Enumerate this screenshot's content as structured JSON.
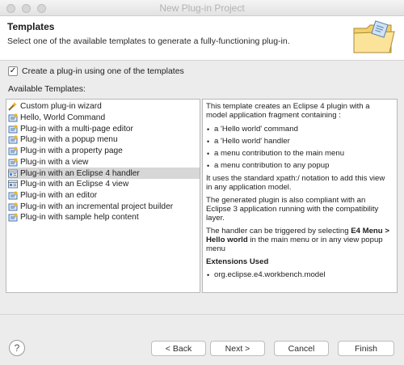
{
  "window": {
    "title": "New Plug-in Project"
  },
  "header": {
    "title": "Templates",
    "description": "Select one of the available templates to generate a fully-functioning plug-in."
  },
  "options": {
    "create_from_template_label": "Create a plug-in using one of the templates",
    "create_from_template_checked": true,
    "check_glyph": "✓"
  },
  "available_label": "Available Templates:",
  "templates": [
    {
      "label": "Custom plug-in wizard",
      "icon": "wizard-wand-icon",
      "selected": false
    },
    {
      "label": "Hello, World Command",
      "icon": "plugin-template-icon",
      "selected": false
    },
    {
      "label": "Plug-in with a multi-page editor",
      "icon": "plugin-template-icon",
      "selected": false
    },
    {
      "label": "Plug-in with a popup menu",
      "icon": "plugin-template-icon",
      "selected": false
    },
    {
      "label": "Plug-in with a property page",
      "icon": "plugin-template-icon",
      "selected": false
    },
    {
      "label": "Plug-in with a view",
      "icon": "plugin-template-icon",
      "selected": false
    },
    {
      "label": "Plug-in with an Eclipse 4 handler",
      "icon": "e4-template-icon",
      "selected": true
    },
    {
      "label": "Plug-in with an Eclipse 4 view",
      "icon": "e4-template-icon",
      "selected": false
    },
    {
      "label": "Plug-in with an editor",
      "icon": "plugin-template-icon",
      "selected": false
    },
    {
      "label": "Plug-in with an incremental project builder",
      "icon": "plugin-template-icon",
      "selected": false
    },
    {
      "label": "Plug-in with sample help content",
      "icon": "plugin-template-icon",
      "selected": false
    }
  ],
  "description": {
    "intro1": "This template creates an Eclipse 4 plugin with a",
    "intro2": "model application fragment containing :",
    "bullet1": "a 'Hello world' command",
    "bullet2": "a 'Hello world' handler",
    "bullet3": "a menu contribution to the main menu",
    "bullet4": "a menu contribution to any popup",
    "xpath1": "It uses the standard xpath:/ notation to add this view",
    "xpath2": "in any application model.",
    "compat1": "The generated plugin is also compliant with an",
    "compat2": "Eclipse 3 application running with the compatibility",
    "compat3": "layer.",
    "trigger1": "The handler can be triggered by selecting",
    "trigger_bold1": "E4 Menu >",
    "trigger_bold2": "Hello world",
    "trigger2": "in the main menu or in any view popup",
    "trigger3": "menu",
    "extensions_heading": "Extensions Used",
    "extension1": "org.eclipse.e4.workbench.model",
    "bullet_glyph": "•"
  },
  "buttons": {
    "help_icon": "?",
    "back": "< Back",
    "next": "Next >",
    "cancel": "Cancel",
    "finish": "Finish"
  }
}
